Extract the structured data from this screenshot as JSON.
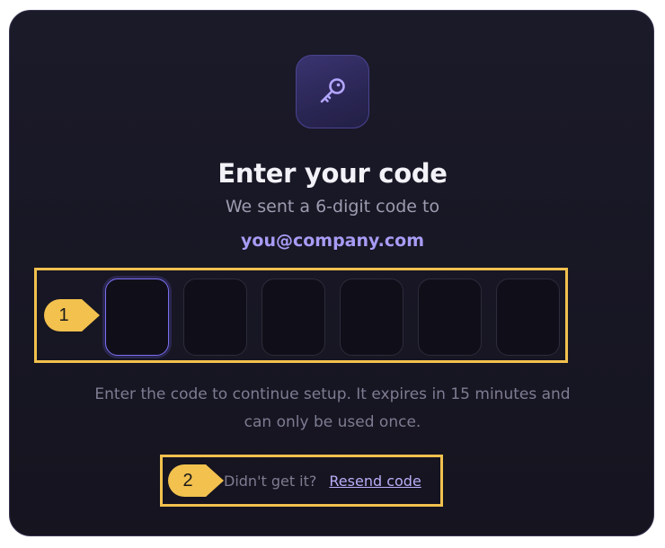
{
  "card": {
    "key_icon": "key-icon",
    "title": "Enter your code",
    "subtitle": "We sent a 6-digit code to",
    "email": "you@company.com",
    "code_inputs": [
      "",
      "",
      "",
      "",
      "",
      ""
    ],
    "active_index": 0,
    "note_line1": "Enter the code to continue setup. It expires in 15 minutes and",
    "note_line2": "can only be used once.",
    "resend_prompt": "Didn't get it?",
    "resend_label": "Resend code"
  },
  "annotations": [
    {
      "number": "1",
      "target": "code-inputs"
    },
    {
      "number": "2",
      "target": "resend-row"
    }
  ],
  "colors": {
    "card_background": "#1b1a29",
    "accent": "#a79cf5",
    "annotation": "#f2c14e"
  }
}
